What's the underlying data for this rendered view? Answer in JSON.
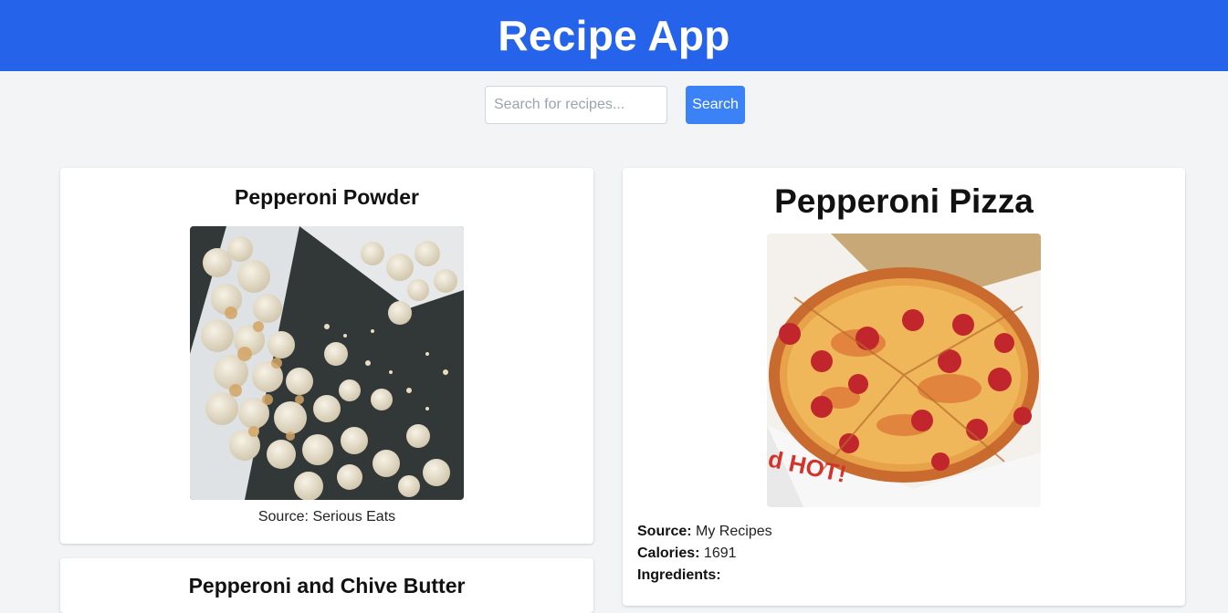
{
  "header": {
    "title": "Recipe App",
    "color": "#2563eb"
  },
  "search": {
    "placeholder": "Search for recipes...",
    "value": "",
    "button_label": "Search",
    "button_color": "#3b82f6"
  },
  "results": [
    {
      "title": "Pepperoni Powder",
      "source_label": "Source:",
      "source": "Serious Eats",
      "image": "popcorn-photo"
    },
    {
      "title": "Pepperoni and Chive Butter"
    }
  ],
  "detail": {
    "title": "Pepperoni Pizza",
    "image": "pizza-photo",
    "source_label": "Source:",
    "source": "My Recipes",
    "calories_label": "Calories:",
    "calories": "1691",
    "ingredients_label": "Ingredients:",
    "box_text": "d HOT!"
  }
}
